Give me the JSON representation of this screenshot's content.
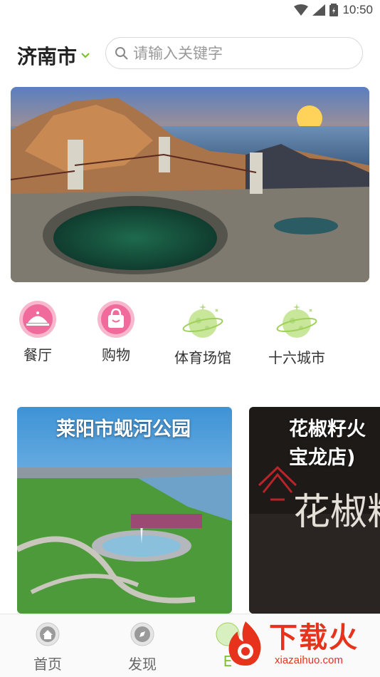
{
  "status_bar": {
    "time": "10:50"
  },
  "header": {
    "city": "济南市",
    "search_placeholder": "请输入关键字"
  },
  "banner": {
    "alt": "banner-image"
  },
  "categories": [
    {
      "label": "餐厅",
      "icon": "restaurant-icon"
    },
    {
      "label": "购物",
      "icon": "shopping-bag-icon"
    },
    {
      "label": "体育场馆",
      "icon": "planet-icon"
    },
    {
      "label": "十六城市",
      "icon": "planet-icon"
    }
  ],
  "cards": [
    {
      "title": "莱阳市蚬河公园"
    },
    {
      "title_line1": "花椒籽火",
      "title_line2": "宝龙店)"
    }
  ],
  "tabbar": {
    "tabs": [
      {
        "label": "首页",
        "icon": "home-icon"
      },
      {
        "label": "发现",
        "icon": "compass-icon"
      },
      {
        "label": "E",
        "icon": "tab3-icon"
      }
    ]
  },
  "watermark": {
    "brand": "下载火",
    "url": "xiazaihuo.com"
  },
  "colors": {
    "accent_green": "#7cc22f",
    "pink": "#f06b9b",
    "brand_red": "#e8331c"
  }
}
